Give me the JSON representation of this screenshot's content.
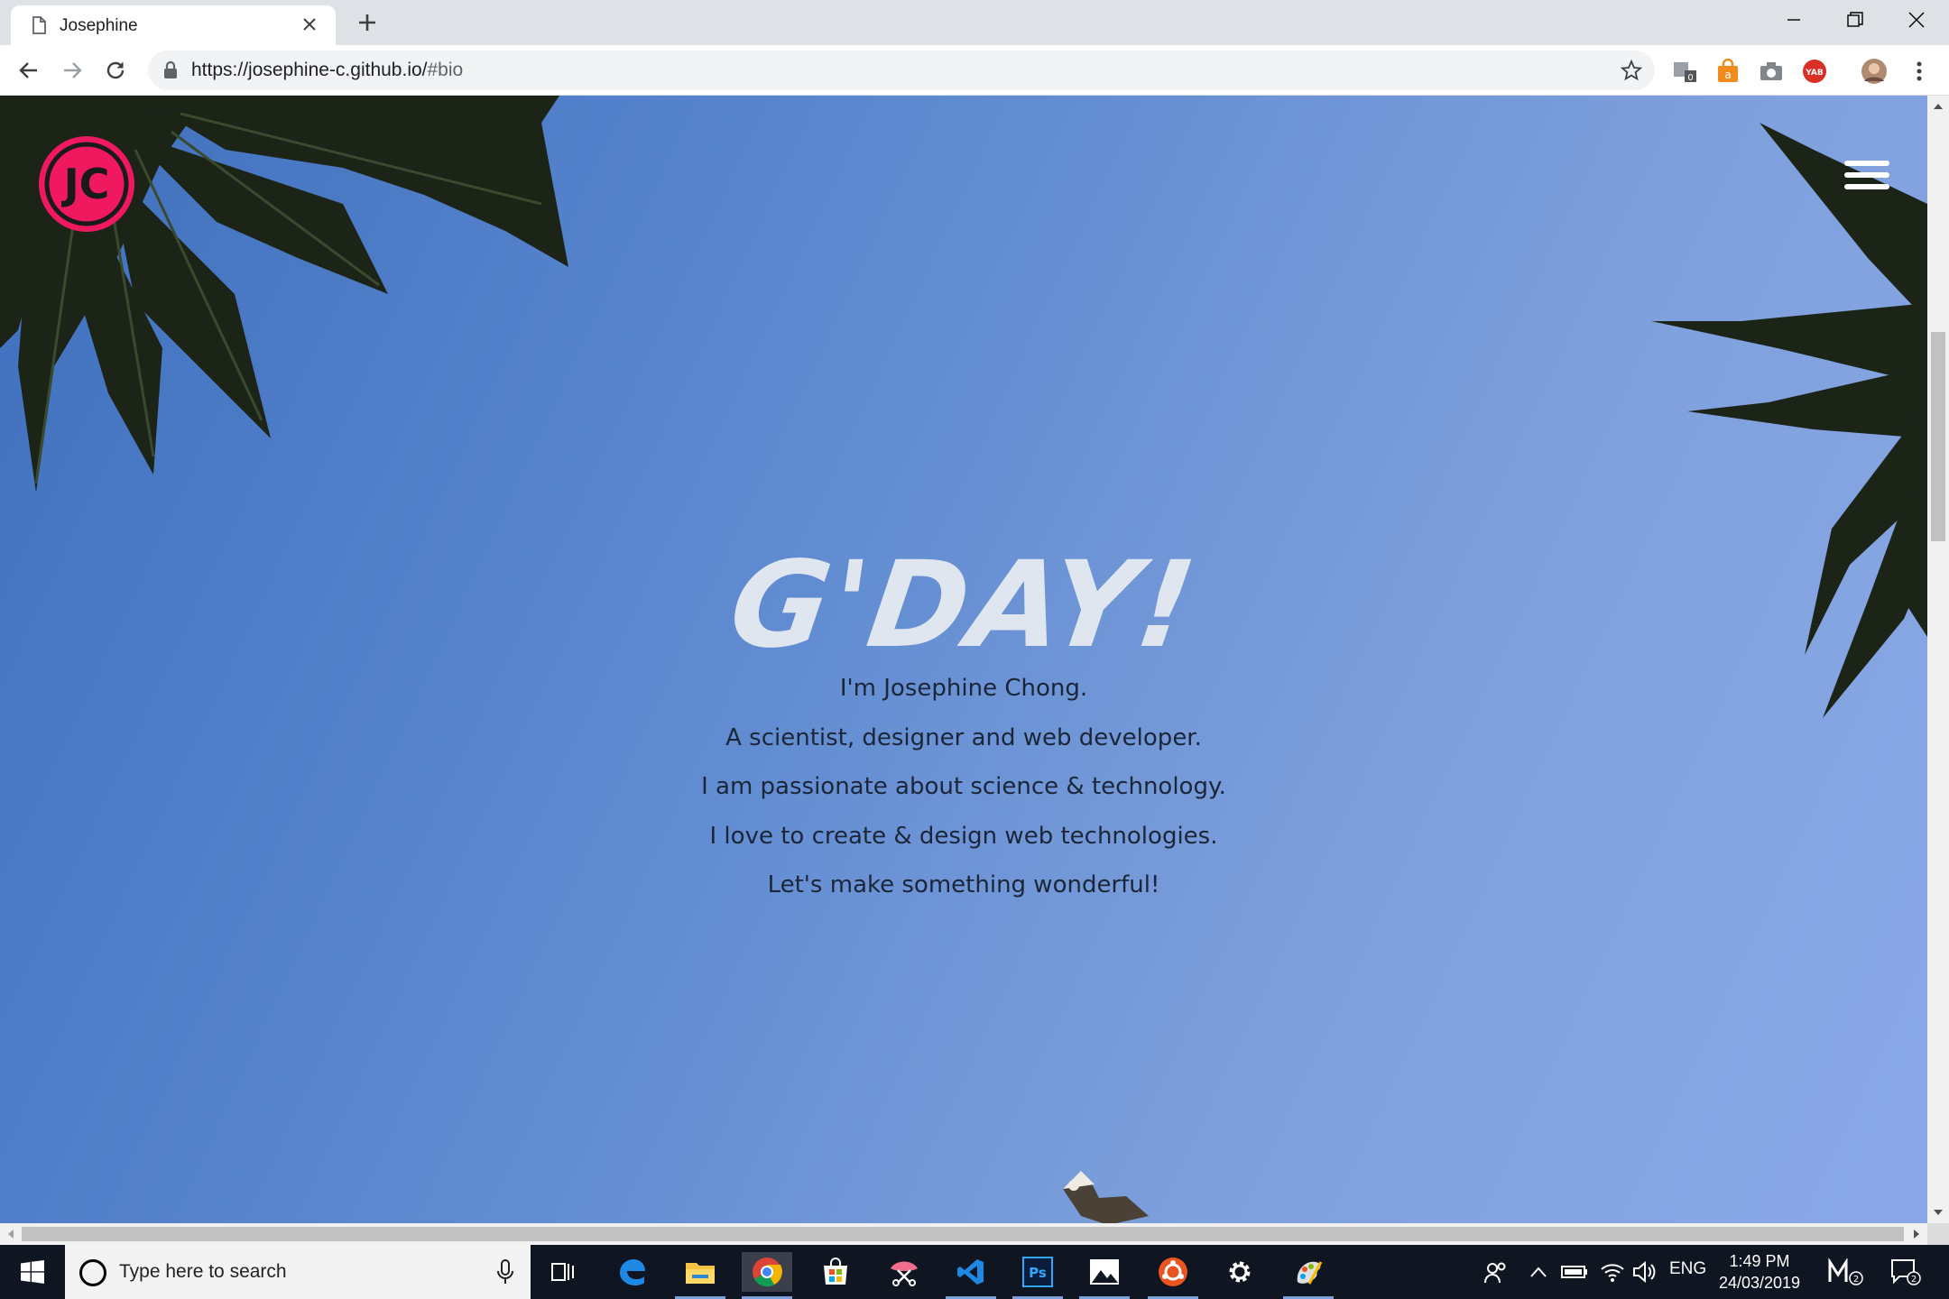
{
  "browser": {
    "tab": {
      "title": "Josephine"
    },
    "url": {
      "base": "https://josephine-c.github.io/",
      "fragment": "#bio"
    }
  },
  "page": {
    "logo_text": "JC",
    "heading": "G'DAY!",
    "lines": [
      "I'm Josephine Chong.",
      "A scientist, designer and web developer.",
      "I am passionate about science & technology.",
      "I love to create & design web technologies.",
      "Let's make something wonderful!"
    ]
  },
  "extensions": {
    "badge_count": "0",
    "yab_label": "YAB"
  },
  "taskbar": {
    "search_placeholder": "Type here to search",
    "language": "ENG",
    "time": "1:49 PM",
    "date": "24/03/2019",
    "notification_count": "2"
  },
  "colors": {
    "accent_pink": "#f0195f",
    "sky": "#5a87cf"
  }
}
